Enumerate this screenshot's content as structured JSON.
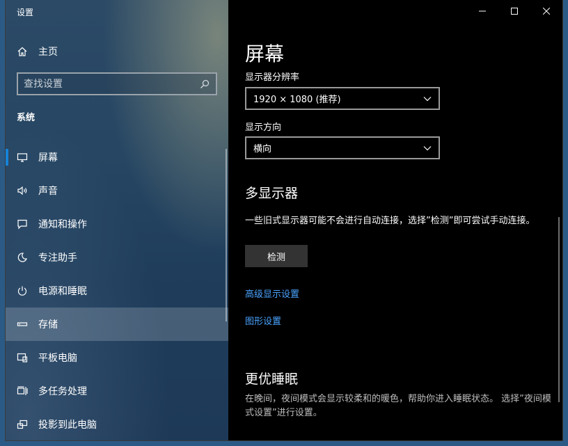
{
  "app": {
    "title": "设置"
  },
  "window_controls": [
    "minimize",
    "maximize",
    "close"
  ],
  "sidebar": {
    "home_label": "主页",
    "search_placeholder": "查找设置",
    "section_title": "系统",
    "items": [
      {
        "label": "屏幕",
        "icon": "monitor-icon",
        "active": true
      },
      {
        "label": "声音",
        "icon": "speaker-icon"
      },
      {
        "label": "通知和操作",
        "icon": "notification-icon"
      },
      {
        "label": "专注助手",
        "icon": "moon-icon"
      },
      {
        "label": "电源和睡眠",
        "icon": "power-icon"
      },
      {
        "label": "存储",
        "icon": "storage-icon",
        "hover": true
      },
      {
        "label": "平板电脑",
        "icon": "tablet-icon"
      },
      {
        "label": "多任务处理",
        "icon": "multitask-icon"
      },
      {
        "label": "投影到此电脑",
        "icon": "projection-icon"
      }
    ]
  },
  "main": {
    "title": "屏幕",
    "resolution_label": "显示器分辨率",
    "resolution_value": "1920 × 1080 (推荐)",
    "orientation_label": "显示方向",
    "orientation_value": "横向",
    "multi_display_heading": "多显示器",
    "multi_display_desc": "一些旧式显示器可能不会进行自动连接，选择”检测”即可尝试手动连接。",
    "detect_button": "检测",
    "advanced_link": "高级显示设置",
    "graphics_link": "图形设置",
    "sleep_heading": "更优睡眠",
    "sleep_desc": "在晚间，夜间模式会显示较柔和的暖色，帮助你进入睡眠状态。 选择”夜间模式设置”进行设置。"
  },
  "colors": {
    "accent": "#1683d8",
    "link": "#4aa3ff",
    "content_bg": "#000000"
  }
}
